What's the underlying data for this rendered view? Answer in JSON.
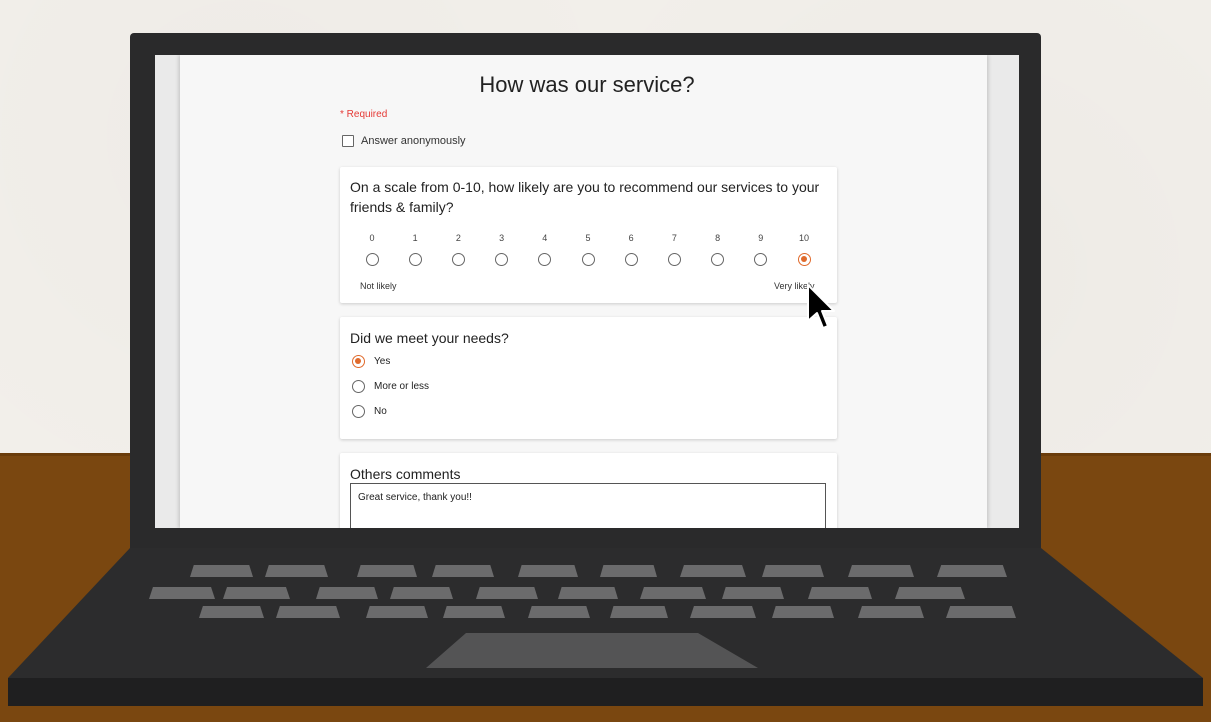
{
  "form": {
    "title": "How was our service?",
    "required_note": "* Required",
    "anonymous_label": "Answer anonymously",
    "anonymous_checked": false
  },
  "q1": {
    "text": "On a scale from 0-10, how likely are you to recommend our services to your friends & family?",
    "scale": [
      "0",
      "1",
      "2",
      "3",
      "4",
      "5",
      "6",
      "7",
      "8",
      "9",
      "10"
    ],
    "selected": 10,
    "low_label": "Not likely",
    "high_label": "Very likely"
  },
  "q2": {
    "text": "Did we meet your needs?",
    "options": [
      "Yes",
      "More or less",
      "No"
    ],
    "selected": 0
  },
  "q3": {
    "label": "Others comments",
    "value": "Great service, thank you!!"
  },
  "colors": {
    "accent": "#e06a2c",
    "required": "#e53935",
    "laptop": "#2a2a2b",
    "desk": "#7a4710"
  }
}
